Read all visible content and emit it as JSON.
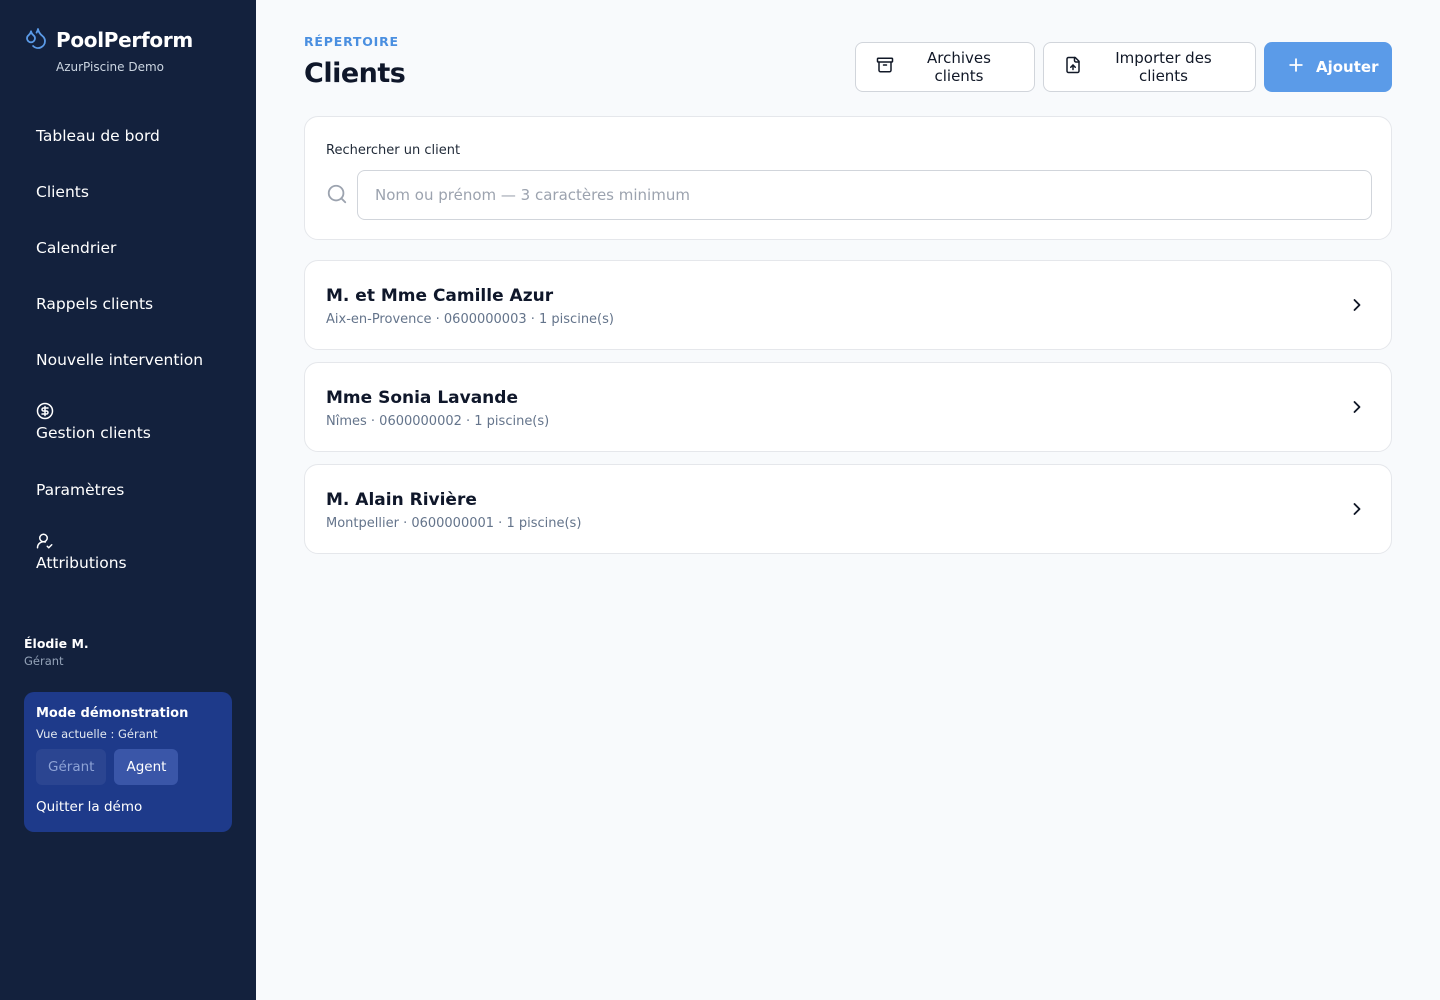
{
  "brand": {
    "name": "PoolPerform",
    "subtitle": "AzurPiscine Demo",
    "logo_icon": "water-drops-icon"
  },
  "nav": {
    "items": [
      {
        "label": "Tableau de bord"
      },
      {
        "label": "Clients"
      },
      {
        "label": "Calendrier"
      },
      {
        "label": "Rappels clients"
      },
      {
        "label": "Nouvelle intervention"
      },
      {
        "label": "Gestion clients",
        "icon": "dollar-circle-icon"
      },
      {
        "label": "Paramètres"
      },
      {
        "label": "Attributions",
        "icon": "user-check-icon"
      }
    ]
  },
  "user": {
    "name": "Élodie M.",
    "role": "Gérant"
  },
  "demo": {
    "title": "Mode démonstration",
    "current_view": "Vue actuelle : Gérant",
    "btn_manager": "Gérant",
    "btn_agent": "Agent",
    "quit": "Quitter la démo"
  },
  "header": {
    "eyebrow": "RÉPERTOIRE",
    "title": "Clients",
    "archives_label": "Archives clients",
    "import_label": "Importer des clients",
    "add_label": "Ajouter"
  },
  "search": {
    "label": "Rechercher un client",
    "placeholder": "Nom ou prénom — 3 caractères minimum",
    "value": ""
  },
  "clients": [
    {
      "name": "M. et Mme Camille Azur",
      "meta": "Aix-en-Provence · 0600000003 · 1 piscine(s)"
    },
    {
      "name": "Mme Sonia Lavande",
      "meta": "Nîmes · 0600000002 · 1 piscine(s)"
    },
    {
      "name": "M. Alain Rivière",
      "meta": "Montpellier · 0600000001 · 1 piscine(s)"
    }
  ],
  "colors": {
    "sidebar_bg": "#13213d",
    "demo_panel_bg": "#1e3a8a",
    "accent": "#5b9be8",
    "eyebrow": "#4a8fe0"
  }
}
